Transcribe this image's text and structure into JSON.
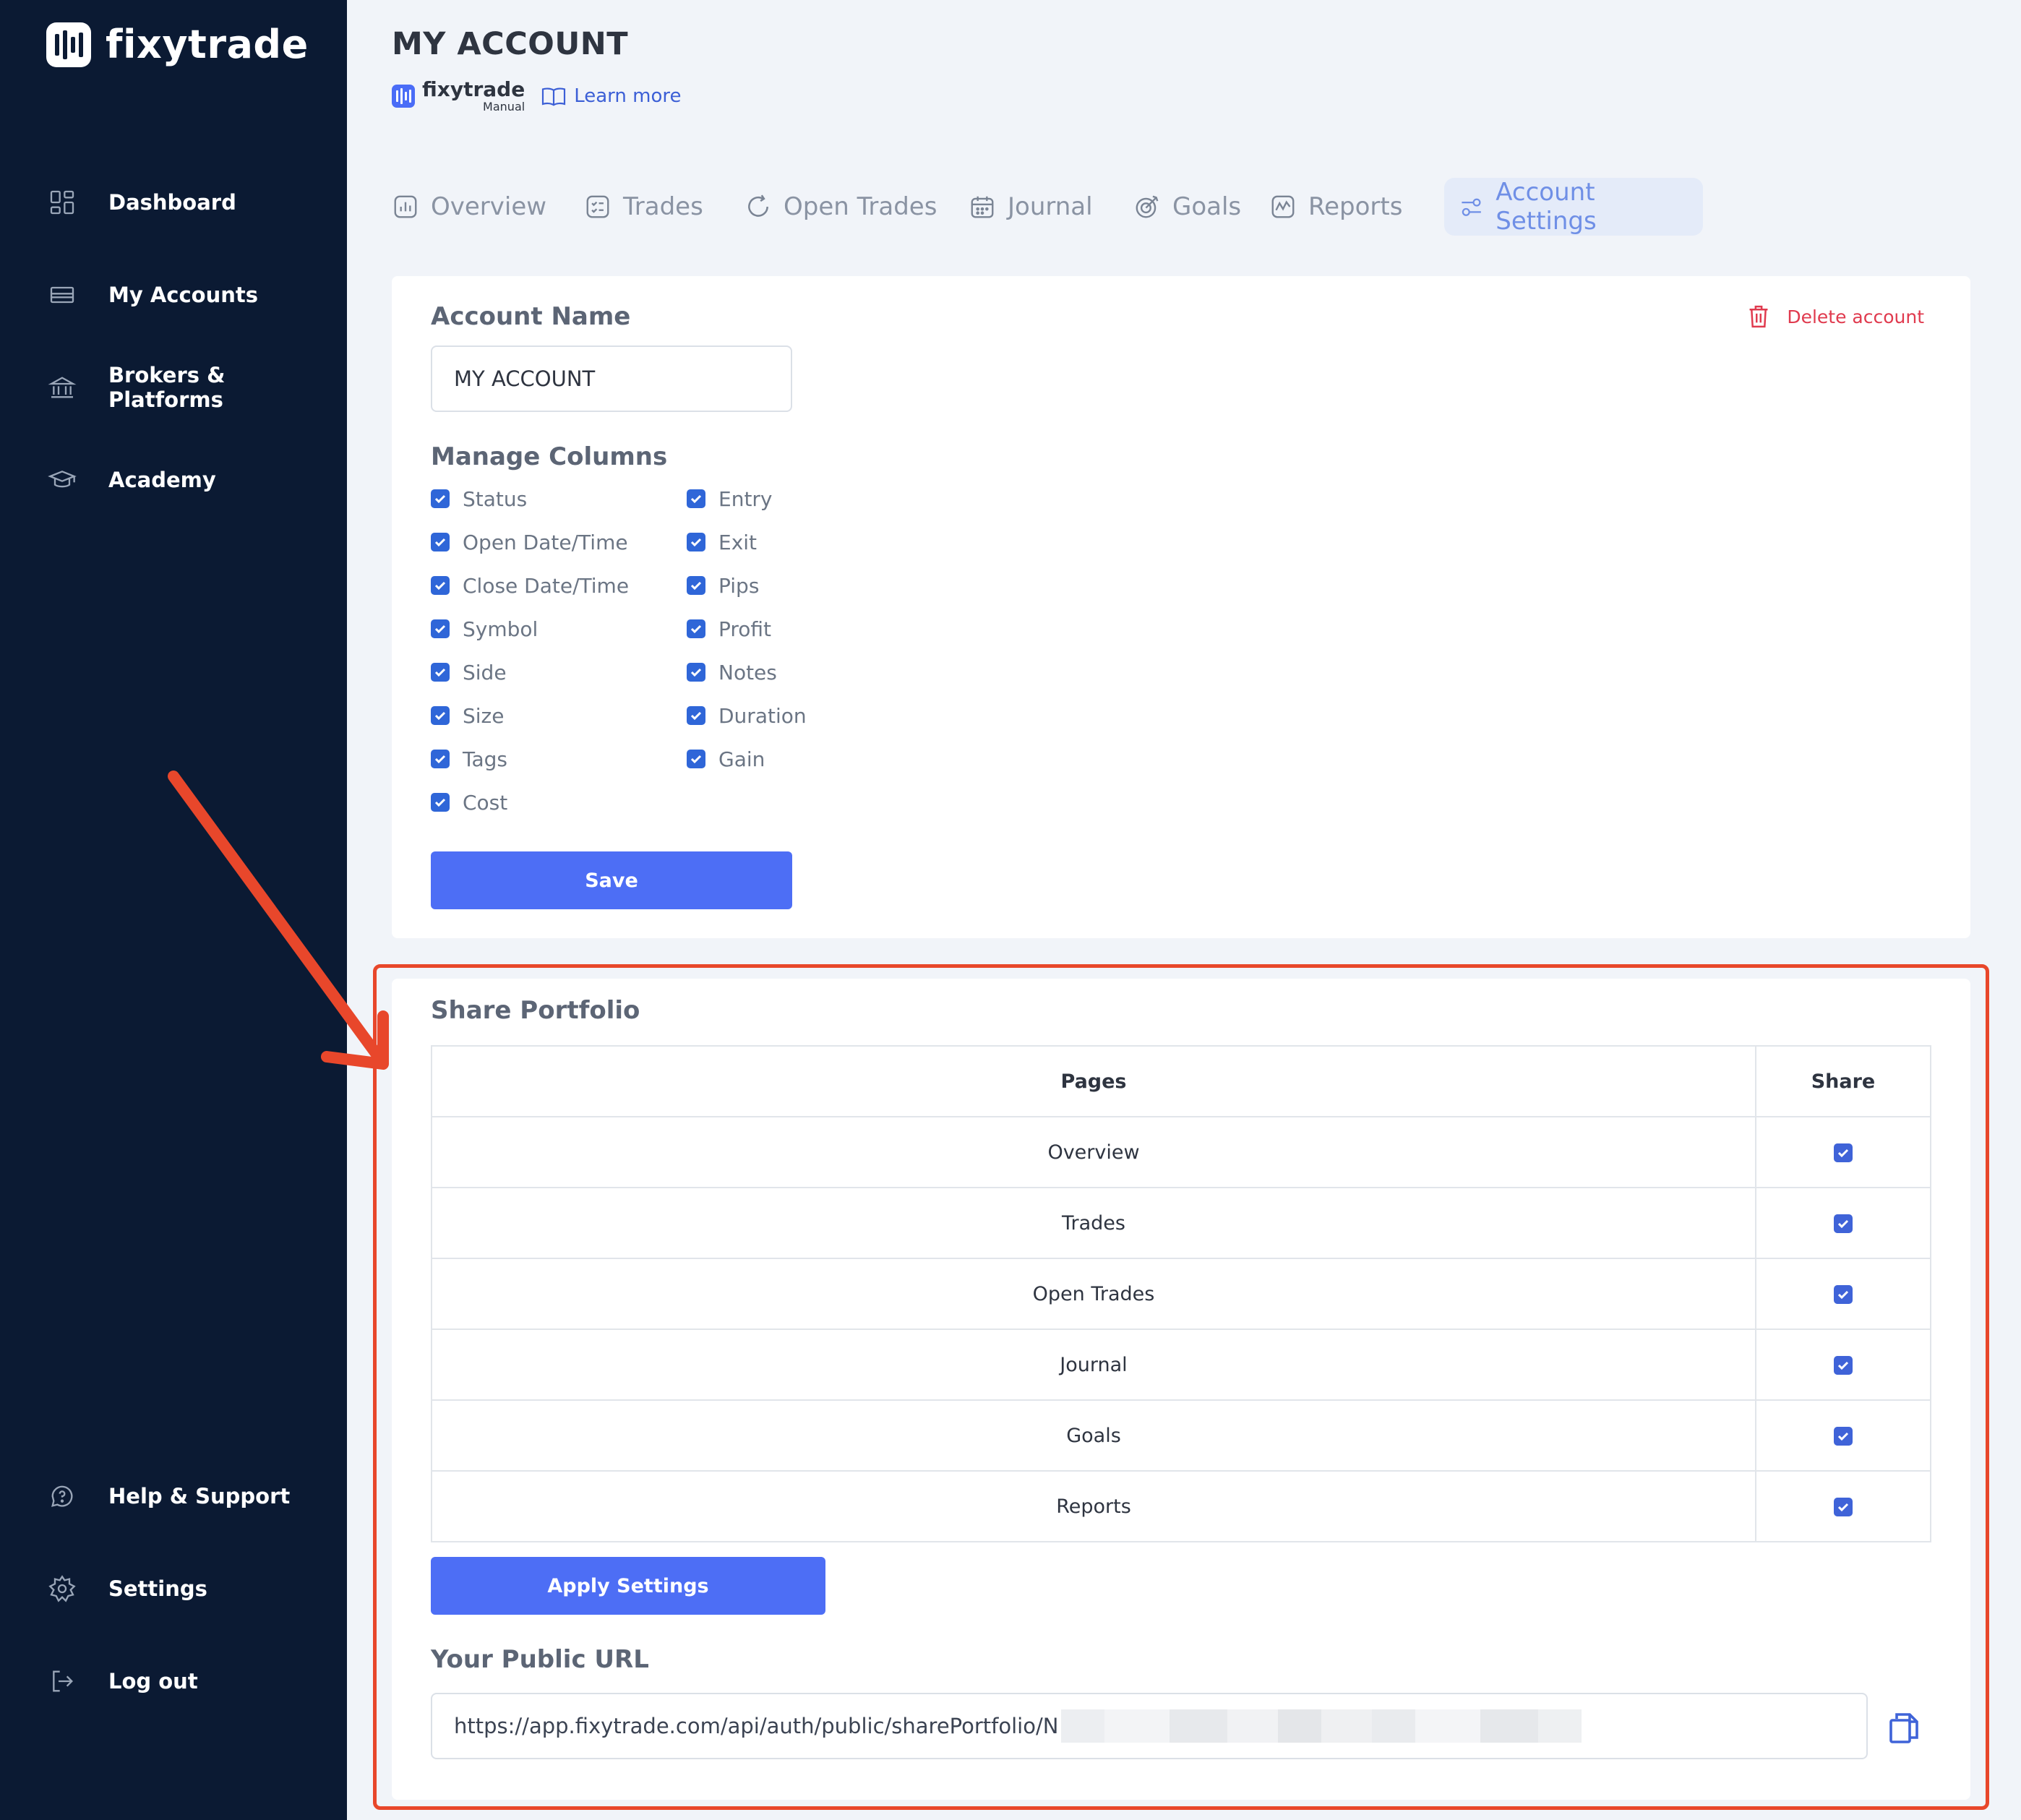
{
  "brand": {
    "name": "fixytrade"
  },
  "sidebar": {
    "items": [
      {
        "label": "Dashboard",
        "icon": "dashboard-icon"
      },
      {
        "label": "My Accounts",
        "icon": "accounts-icon"
      },
      {
        "label": "Brokers & Platforms",
        "icon": "bank-icon"
      },
      {
        "label": "Academy",
        "icon": "graduation-cap-icon"
      }
    ],
    "bottom_items": [
      {
        "label": "Help & Support",
        "icon": "help-icon"
      },
      {
        "label": "Settings",
        "icon": "gear-icon"
      },
      {
        "label": "Log out",
        "icon": "logout-icon"
      }
    ]
  },
  "header": {
    "title": "MY ACCOUNT",
    "manual_brand": "fixytrade",
    "manual_sub": "Manual",
    "learn_more": "Learn more"
  },
  "tabs": [
    {
      "label": "Overview",
      "icon": "chart-icon"
    },
    {
      "label": "Trades",
      "icon": "list-icon"
    },
    {
      "label": "Open Trades",
      "icon": "refresh-icon"
    },
    {
      "label": "Journal",
      "icon": "calendar-icon"
    },
    {
      "label": "Goals",
      "icon": "target-icon"
    },
    {
      "label": "Reports",
      "icon": "report-icon"
    },
    {
      "label": "Account Settings",
      "icon": "sliders-icon",
      "active": true
    }
  ],
  "account_settings": {
    "account_name_label": "Account Name",
    "account_name_value": "MY ACCOUNT",
    "delete_label": "Delete account",
    "manage_columns_label": "Manage Columns",
    "columns_left": [
      "Status",
      "Open Date/Time",
      "Close Date/Time",
      "Symbol",
      "Side",
      "Size",
      "Tags",
      "Cost"
    ],
    "columns_right": [
      "Entry",
      "Exit",
      "Pips",
      "Profit",
      "Notes",
      "Duration",
      "Gain"
    ],
    "save_label": "Save"
  },
  "share_portfolio": {
    "title": "Share Portfolio",
    "headers": {
      "pages": "Pages",
      "share": "Share"
    },
    "rows": [
      "Overview",
      "Trades",
      "Open Trades",
      "Journal",
      "Goals",
      "Reports"
    ],
    "apply_label": "Apply Settings",
    "public_url_label": "Your Public URL",
    "public_url_value": "https://app.fixytrade.com/api/auth/public/sharePortfolio/N"
  },
  "colors": {
    "sidebar_bg": "#0b1a33",
    "primary": "#4d6ef5",
    "danger": "#e03a4e",
    "highlight": "#e8472b"
  }
}
